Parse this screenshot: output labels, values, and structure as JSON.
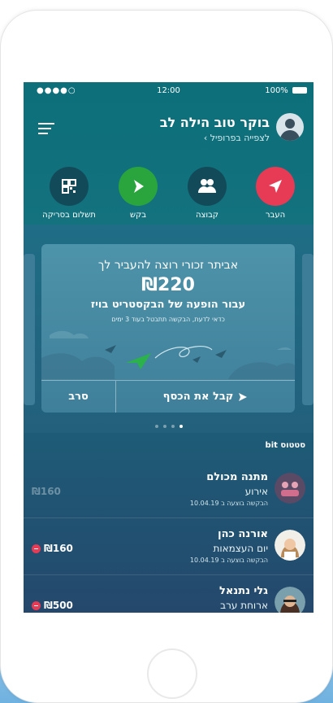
{
  "statusbar": {
    "signal": "●●●●○",
    "time": "12:00",
    "battery": "100%"
  },
  "header": {
    "greeting": "בוקר טוב הילה לב",
    "profile_link": "לצפייה בפרופיל ›"
  },
  "actions": [
    {
      "label": "העבר"
    },
    {
      "label": "קבוצה"
    },
    {
      "label": "בקש"
    },
    {
      "label": "תשלום בסריקה"
    }
  ],
  "request_card": {
    "line1": "אביתר זכורי רוצה להעביר לך",
    "amount": "₪220",
    "line2": "עבור הופעה של הבקסטריט בויז",
    "line3": "כדאי לדעת, הבקשה תתבטל בעוד 3 ימים",
    "accept_label": "קבל את הכסף",
    "decline_label": "סרב"
  },
  "carousel": {
    "page_count": 4,
    "active_index": 3
  },
  "status_section": {
    "title": "סטטוס bit"
  },
  "transactions": [
    {
      "name": "מתנה מכולם",
      "subtitle": "אירוע",
      "date": "הבקשה בוצעה ב 10.04.19",
      "amount": "₪160",
      "muted": true
    },
    {
      "name": "אורנה כהן",
      "subtitle": "יום העצמאות",
      "date": "הבקשה בוצעה ב 10.04.19",
      "amount": "₪160",
      "muted": false
    },
    {
      "name": "גלי נתנאל",
      "subtitle": "ארוחת ערב",
      "date": "",
      "amount": "₪500",
      "muted": false
    }
  ],
  "colors": {
    "accent_red": "#e73a55",
    "accent_green": "#2aa53e",
    "teal_bg": "#0c6f7a",
    "icon_bg": "#124a59"
  }
}
